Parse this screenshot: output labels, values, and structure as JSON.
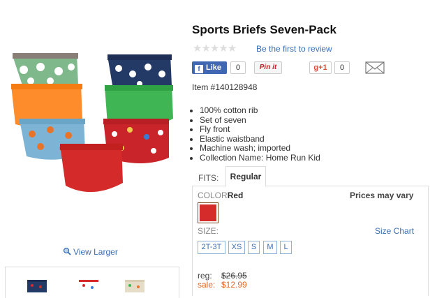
{
  "product": {
    "title": "Sports Briefs Seven-Pack",
    "review_link": "Be the first to review",
    "stars": [
      "★",
      "★",
      "★",
      "★",
      "★"
    ],
    "item_number": "Item #140128948",
    "view_larger": "View Larger",
    "features": [
      "100% cotton rib",
      "Set of seven",
      "Fly front",
      "Elastic waistband",
      "Machine wash; imported",
      "Collection Name: Home Run Kid"
    ]
  },
  "social": {
    "like_label": "Like",
    "like_count": "0",
    "pin_label": "Pin it",
    "gplus_label": "g+1",
    "gplus_count": "0",
    "email_icon": "envelope-icon"
  },
  "fits": {
    "label": "FITS:",
    "selected_tab": "Regular"
  },
  "color": {
    "label": "COLOR",
    "selected": "Red",
    "swatch_color": "#d62b2b",
    "prices_note": "Prices may vary"
  },
  "size": {
    "label": "SIZE:",
    "chart_link": "Size Chart",
    "options": [
      "2T-3T",
      "XS",
      "S",
      "M",
      "L"
    ]
  },
  "price": {
    "reg_label": "reg:",
    "reg_value": "$26.95",
    "sale_label": "sale:",
    "sale_value": "$12.99"
  },
  "colors": {
    "link": "#3b6fb5",
    "sale": "#e8641c",
    "facebook": "#4267b2",
    "pinterest": "#cb2027",
    "gplus": "#dd4b39"
  }
}
